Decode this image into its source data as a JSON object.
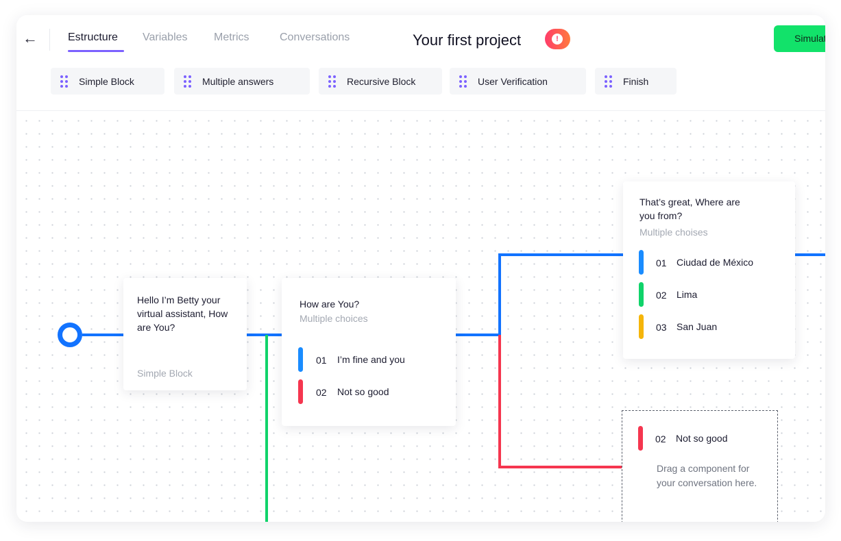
{
  "header": {
    "back_label": "←",
    "tabs": [
      {
        "label": "Estructure",
        "active": true
      },
      {
        "label": "Variables",
        "active": false
      },
      {
        "label": "Metrics",
        "active": false
      },
      {
        "label": "Conversations",
        "active": false
      }
    ],
    "project_title": "Your first project",
    "alert_label": "!",
    "simulate_label": "Simulate"
  },
  "blocks": [
    {
      "label": "Simple Block",
      "icon": "drag-grip-icon"
    },
    {
      "label": "Multiple answers",
      "icon": "drag-grip-icon"
    },
    {
      "label": "Recursive Block",
      "icon": "drag-grip-icon"
    },
    {
      "label": "User Verification",
      "icon": "drag-grip-icon"
    },
    {
      "label": "Finish",
      "icon": "drag-grip-icon"
    }
  ],
  "canvas": {
    "greeting_card": {
      "title": "Hello I’m Betty your virtual assistant, How are You?",
      "type_label": "Simple Block"
    },
    "question_card": {
      "title": "How are You?",
      "type_label": "Multiple choices",
      "options": [
        {
          "num": "01",
          "label": "I’m fine and you",
          "color": "#1a8cff"
        },
        {
          "num": "02",
          "label": "Not so good",
          "color": "#f5364f"
        }
      ]
    },
    "location_card": {
      "title": "That’s great, Where are you from?",
      "type_label": "Multiple choises",
      "options": [
        {
          "num": "01",
          "label": "Ciudad de México",
          "color": "#1a8cff"
        },
        {
          "num": "02",
          "label": "Lima",
          "color": "#10d36a"
        },
        {
          "num": "03",
          "label": "San Juan",
          "color": "#f5b50a"
        }
      ]
    },
    "dropzone": {
      "num": "02",
      "label": "Not so good",
      "color": "#f5364f",
      "hint": "Drag a component for your conversation here."
    }
  },
  "colors": {
    "accent": "#7b61ff",
    "flow_blue": "#1273ff",
    "flow_green": "#10d36a",
    "flow_red": "#f5364f",
    "simulate_green": "#12e26a"
  }
}
